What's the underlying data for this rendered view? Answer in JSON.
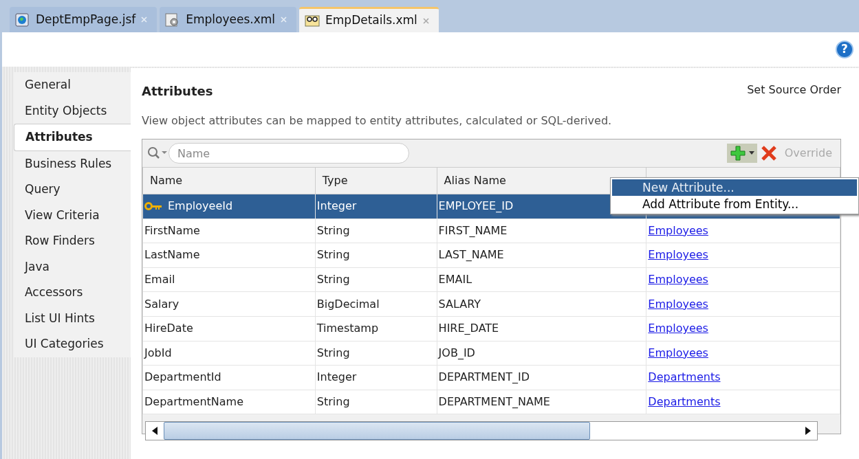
{
  "tabs": [
    {
      "label": "DeptEmpPage.jsf",
      "kind": "page",
      "selected": false
    },
    {
      "label": "Employees.xml",
      "kind": "gear",
      "selected": false
    },
    {
      "label": "EmpDetails.xml",
      "kind": "glasses",
      "selected": true
    }
  ],
  "help": {
    "label": "?"
  },
  "sidebar": {
    "items": [
      {
        "label": "General",
        "selected": false
      },
      {
        "label": "Entity Objects",
        "selected": false
      },
      {
        "label": "Attributes",
        "selected": true
      },
      {
        "label": "Business Rules",
        "selected": false
      },
      {
        "label": "Query",
        "selected": false
      },
      {
        "label": "View Criteria",
        "selected": false
      },
      {
        "label": "Row Finders",
        "selected": false
      },
      {
        "label": "Java",
        "selected": false
      },
      {
        "label": "Accessors",
        "selected": false
      },
      {
        "label": "List UI Hints",
        "selected": false
      },
      {
        "label": "UI Categories",
        "selected": false
      }
    ]
  },
  "section": {
    "title": "Attributes",
    "action": "Set Source Order",
    "description": "View object attributes can be mapped to entity attributes, calculated or SQL-derived."
  },
  "toolbar": {
    "search_placeholder": "Name",
    "override": {
      "label": "Override",
      "disabled": true
    }
  },
  "table": {
    "columns": [
      "Name",
      "Type",
      "Alias Name"
    ],
    "rows": [
      {
        "name": "EmployeeId",
        "type": "Integer",
        "alias": "EMPLOYEE_ID",
        "primary_key": true,
        "selected": true
      },
      {
        "name": "FirstName",
        "type": "String",
        "alias": "FIRST_NAME",
        "entity": "Employees",
        "primary_key": false,
        "selected": false
      },
      {
        "name": "LastName",
        "type": "String",
        "alias": "LAST_NAME",
        "entity": "Employees",
        "primary_key": false,
        "selected": false
      },
      {
        "name": "Email",
        "type": "String",
        "alias": "EMAIL",
        "entity": "Employees",
        "primary_key": false,
        "selected": false
      },
      {
        "name": "Salary",
        "type": "BigDecimal",
        "alias": "SALARY",
        "entity": "Employees",
        "primary_key": false,
        "selected": false
      },
      {
        "name": "HireDate",
        "type": "Timestamp",
        "alias": "HIRE_DATE",
        "entity": "Employees",
        "primary_key": false,
        "selected": false
      },
      {
        "name": "JobId",
        "type": "String",
        "alias": "JOB_ID",
        "entity": "Employees",
        "primary_key": false,
        "selected": false
      },
      {
        "name": "DepartmentId",
        "type": "Integer",
        "alias": "DEPARTMENT_ID",
        "entity": "Departments",
        "primary_key": false,
        "selected": false
      },
      {
        "name": "DepartmentName",
        "type": "String",
        "alias": "DEPARTMENT_NAME",
        "entity": "Departments",
        "primary_key": false,
        "selected": false
      }
    ]
  },
  "menu": {
    "items": [
      {
        "label": "New Attribute...",
        "selected": true
      },
      {
        "label": "Add Attribute from Entity...",
        "selected": false
      }
    ]
  }
}
